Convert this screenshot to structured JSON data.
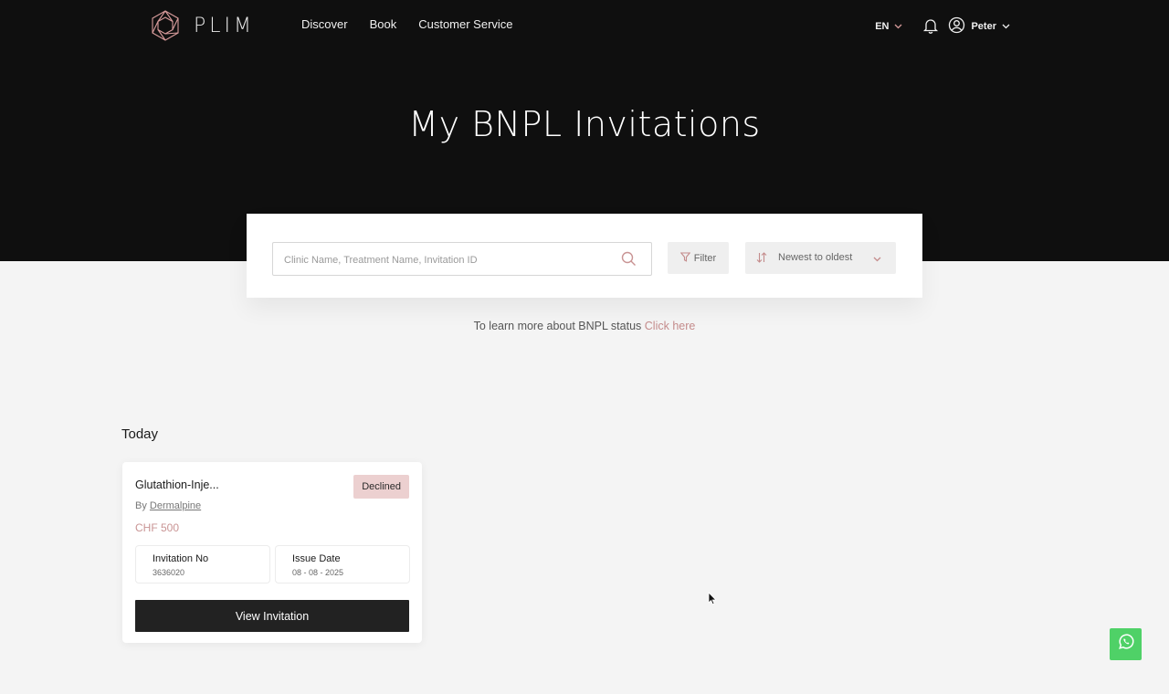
{
  "header": {
    "brand": "PLIM",
    "nav": [
      {
        "label": "Discover"
      },
      {
        "label": "Book"
      },
      {
        "label": "Customer Service"
      }
    ],
    "language": "EN",
    "user_name": "Peter"
  },
  "hero": {
    "title": "My BNPL Invitations"
  },
  "search": {
    "placeholder": "Clinic Name, Treatment Name, Invitation ID",
    "value": "",
    "filter_label": "Filter",
    "sort_label": "Newest to oldest"
  },
  "info": {
    "text": "To learn more about BNPL status",
    "link": "Click here"
  },
  "sections": [
    {
      "title": "Today",
      "cards": [
        {
          "title": "Glutathion-Inje...",
          "status": "Declined",
          "by_prefix": "By",
          "clinic": "Dermalpine",
          "price": "CHF 500",
          "invitation_no_label": "Invitation No",
          "invitation_no": "3636020",
          "issue_date_label": "Issue Date",
          "issue_date": "08 - 08 - 2025",
          "button_label": "View Invitation"
        }
      ]
    }
  ],
  "colors": {
    "hero_bg": "#0f0f0f",
    "accent_pink": "#c48b8b",
    "badge_bg": "#ecd0d0",
    "button_dark": "#222222",
    "whatsapp": "#4fd167"
  },
  "icons": {
    "logo": "crystal-logo-icon",
    "language_chevron": "chevron-down-icon",
    "notifications": "bell-icon",
    "user": "user-circle-icon",
    "search": "search-icon",
    "filter": "filter-icon",
    "sort": "sort-arrows-icon",
    "whatsapp": "whatsapp-icon"
  }
}
